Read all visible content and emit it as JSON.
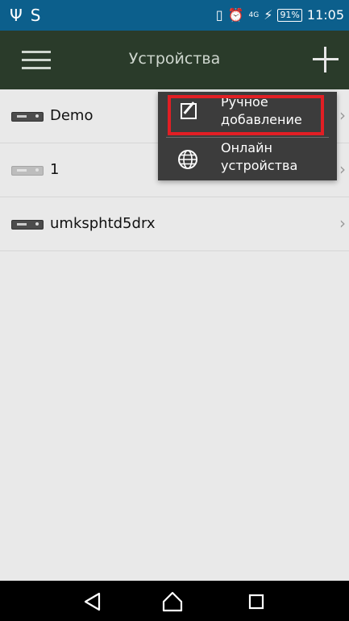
{
  "status_bar": {
    "left_icons": [
      "usb-icon",
      "s-icon"
    ],
    "right_icons": [
      "vibrate-icon",
      "alarm-icon",
      "4g-signal-icon",
      "charging-icon"
    ],
    "network": "4G",
    "battery": "91%",
    "time": "11:05"
  },
  "app_bar": {
    "title": "Устройства",
    "menu_icon": "hamburger-icon",
    "add_icon": "plus-icon",
    "colors": {
      "background": "#2a3b2a",
      "status_bar": "#0c5f8c"
    }
  },
  "devices": [
    {
      "name": "Demo",
      "status": "online"
    },
    {
      "name": "1",
      "status": "offline"
    },
    {
      "name": "umksphtd5drx",
      "status": "online"
    }
  ],
  "popup_menu": {
    "items": [
      {
        "line1": "Ручное",
        "line2": "добавление",
        "icon": "edit-icon",
        "highlighted": true
      },
      {
        "line1": "Онлайн",
        "line2": "устройства",
        "icon": "globe-icon",
        "highlighted": false
      }
    ],
    "highlight_color": "#e21e24"
  },
  "nav_bar": {
    "buttons": [
      "back-icon",
      "home-icon",
      "recent-apps-icon"
    ]
  }
}
